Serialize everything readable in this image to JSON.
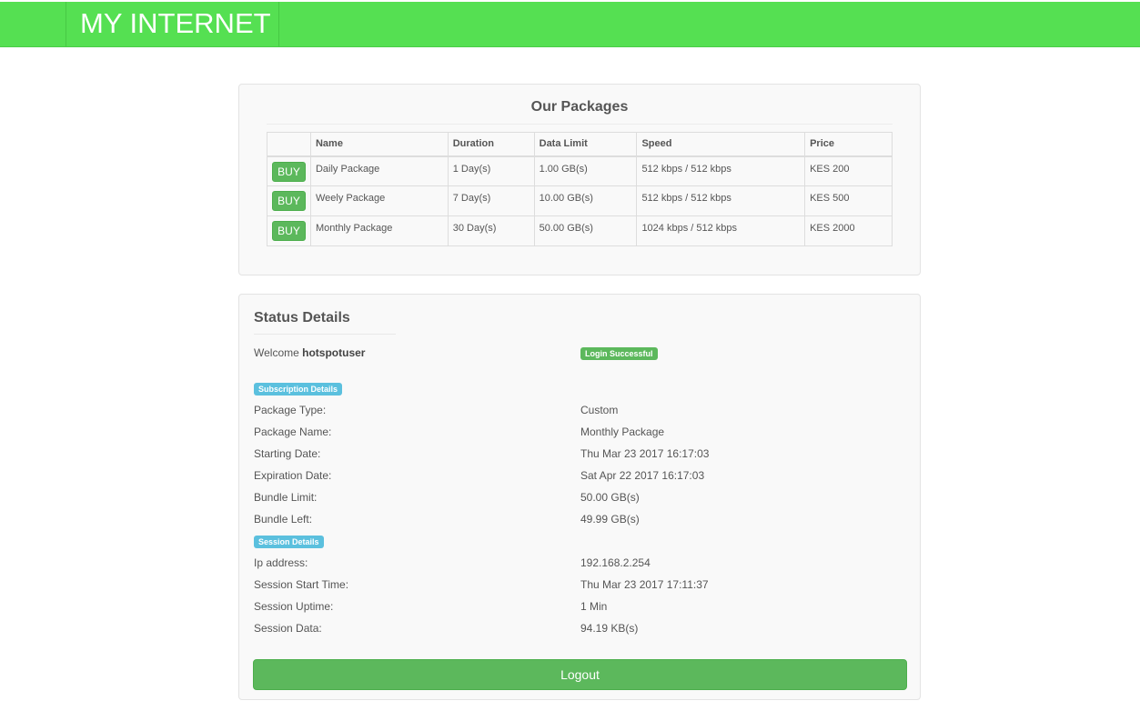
{
  "header": {
    "brand": "MY INTERNET"
  },
  "packages": {
    "title": "Our Packages",
    "columns": [
      "",
      "Name",
      "Duration",
      "Data Limit",
      "Speed",
      "Price"
    ],
    "buy_label": "BUY",
    "rows": [
      {
        "name": "Daily Package",
        "duration": "1 Day(s)",
        "data_limit": "1.00 GB(s)",
        "speed": "512 kbps / 512 kbps",
        "price": "KES 200"
      },
      {
        "name": "Weely Package",
        "duration": "7 Day(s)",
        "data_limit": "10.00 GB(s)",
        "speed": "512 kbps / 512 kbps",
        "price": "KES 500"
      },
      {
        "name": "Monthly Package",
        "duration": "30 Day(s)",
        "data_limit": "50.00 GB(s)",
        "speed": "1024 kbps / 512 kbps",
        "price": "KES 2000"
      }
    ]
  },
  "status": {
    "title": "Status Details",
    "welcome_prefix": "Welcome ",
    "username": "hotspotuser",
    "login_badge": "Login Successful",
    "subscription_badge": "Subscription Details",
    "session_badge": "Session Details",
    "subscription": [
      {
        "label": "Package Type:",
        "value": "Custom"
      },
      {
        "label": "Package Name:",
        "value": "Monthly Package"
      },
      {
        "label": "Starting Date:",
        "value": "Thu Mar 23 2017 16:17:03"
      },
      {
        "label": "Expiration Date:",
        "value": "Sat Apr 22 2017 16:17:03"
      },
      {
        "label": "Bundle Limit:",
        "value": "50.00 GB(s)"
      },
      {
        "label": "Bundle Left:",
        "value": "49.99 GB(s)"
      }
    ],
    "session": [
      {
        "label": "Ip address:",
        "value": "192.168.2.254"
      },
      {
        "label": "Session Start Time:",
        "value": "Thu Mar 23 2017 17:11:37"
      },
      {
        "label": "Session Uptime:",
        "value": "1 Min"
      },
      {
        "label": "Session Data:",
        "value": "94.19 KB(s)"
      }
    ],
    "logout_label": "Logout"
  },
  "colors": {
    "header": "#55e052",
    "success": "#5cb85c",
    "info": "#5bc0de"
  }
}
